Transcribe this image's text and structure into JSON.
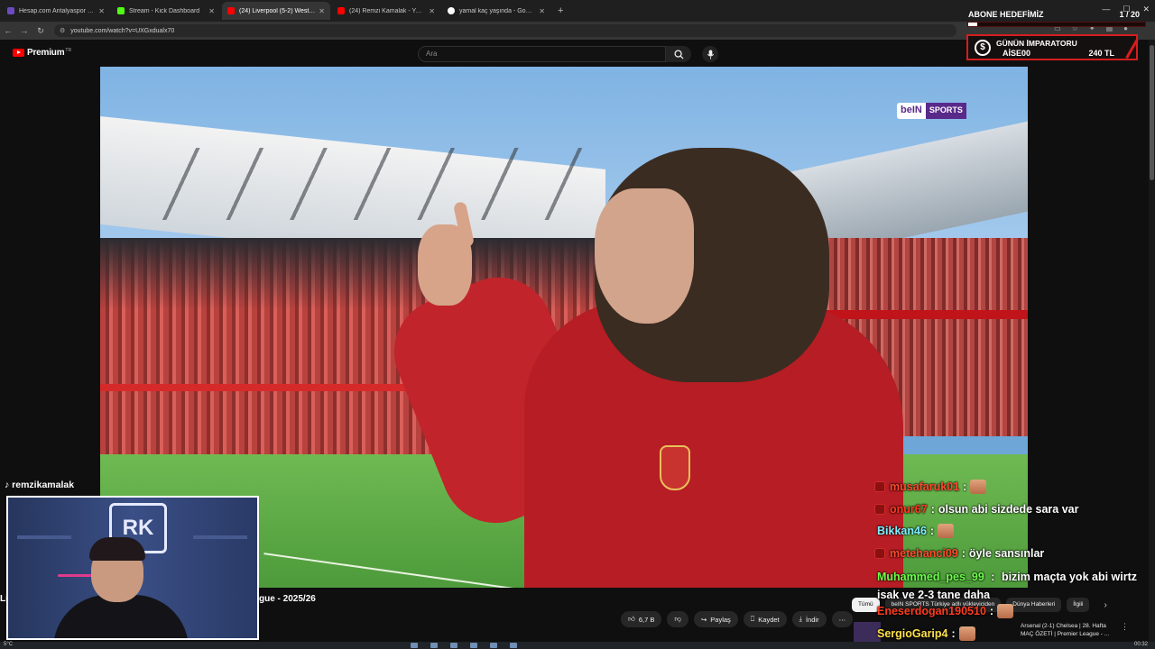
{
  "browser": {
    "tabs": [
      {
        "label": "Hesap.com Antalyaspor - Fene",
        "color": "#6c4bc2",
        "active": false
      },
      {
        "label": "Stream - Kick Dashboard",
        "color": "#53fc18",
        "active": false
      },
      {
        "label": "(24) Liverpool (5-2) West Ham",
        "color": "#ff0000",
        "active": true
      },
      {
        "label": "(24) Remzi Kamalak - YouTube",
        "color": "#ff0000",
        "active": false
      },
      {
        "label": "yamal kaç yaşında - Google'da",
        "color": "#ffffff",
        "active": false
      }
    ],
    "url": "youtube.com/watch?v=UXGxdualx70"
  },
  "youtube": {
    "brand": "Premium",
    "region": "TR",
    "search_placeholder": "Ara",
    "video_title_left": "Li",
    "video_title": "gue - 2025/26",
    "actions": {
      "likes": "6,7 B",
      "share": "Paylaş",
      "save": "Kaydet",
      "download": "İndir"
    },
    "chips": [
      "Tümü",
      "beIN SPORTS Türkiye adlı yükleyiciden",
      "Dünya Haberleri",
      "İlgili"
    ],
    "recommended_title_1": "Arsenal (2-1) Chelsea | 28. Hafta",
    "recommended_title_2": "MAÇ ÖZETİ | Premier League - ..."
  },
  "broadcast": {
    "logo_1": "beIN",
    "logo_2": "SPORTS"
  },
  "overlay": {
    "sub_goal_label": "ABONE HEDEFİMİZ",
    "sub_goal_count": "1 / 20",
    "sub_goal_progress": 0.05,
    "emperor_title": "GÜNÜN İMPARATORU",
    "emperor_name": "AİSE00",
    "emperor_amount": "240 TL",
    "streamer": "remzikamalak",
    "cam_logo": "RK"
  },
  "chat": [
    {
      "user": "musafaruk01",
      "color": "#ff4b2b",
      "message": "",
      "badge": true,
      "emote": true
    },
    {
      "user": "onur67",
      "color": "#ff3b1f",
      "message": "olsun abi sizdede sara var",
      "badge": true,
      "emote": false
    },
    {
      "user": "Bikkan46",
      "color": "#7cf0ff",
      "message": "",
      "badge": false,
      "emote": true
    },
    {
      "user": "metehanci09",
      "color": "#ff4b2b",
      "message": "öyle sansınlar",
      "badge": true,
      "emote": false
    },
    {
      "user": "Muhammed_pes_99",
      "color": "#6cff4a",
      "message": "bizim maçta yok abi wirtz isak ve 2-3 tane daha",
      "badge": false,
      "emote": false
    },
    {
      "user": "Eneserdogan190510",
      "color": "#ff3b1f",
      "message": "",
      "badge": false,
      "emote": true
    },
    {
      "user": "SergioGarip4",
      "color": "#ffe14a",
      "message": "",
      "badge": false,
      "emote": true
    }
  ],
  "system": {
    "temperature": "5°C",
    "time": "00:32"
  }
}
